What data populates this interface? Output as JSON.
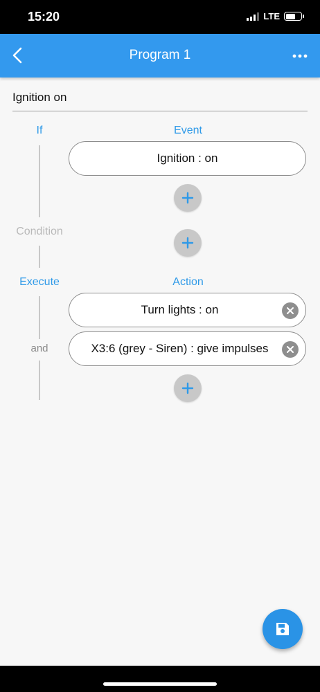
{
  "status_bar": {
    "time": "15:20",
    "network": "LTE",
    "signal_icon": "signal-bars-icon",
    "battery_icon": "battery-icon"
  },
  "app_bar": {
    "title": "Program 1",
    "back_icon": "chevron-left-icon",
    "menu_icon": "more-horizontal-icon"
  },
  "program": {
    "name": "Ignition on",
    "labels": {
      "if": "If",
      "condition": "Condition",
      "execute": "Execute",
      "and": "and"
    },
    "event_header": "Event",
    "action_header": "Action",
    "events": [
      {
        "label": "Ignition : on"
      }
    ],
    "actions": [
      {
        "label": "Turn lights : on"
      },
      {
        "label": "X3:6 (grey - Siren) : give impulses"
      }
    ]
  },
  "fab": {
    "icon": "save-icon"
  },
  "colors": {
    "primary": "#3399ee",
    "accent_text": "#2f9ae8",
    "fab": "#2a93e6",
    "disabled_label": "#b9b9b9"
  }
}
